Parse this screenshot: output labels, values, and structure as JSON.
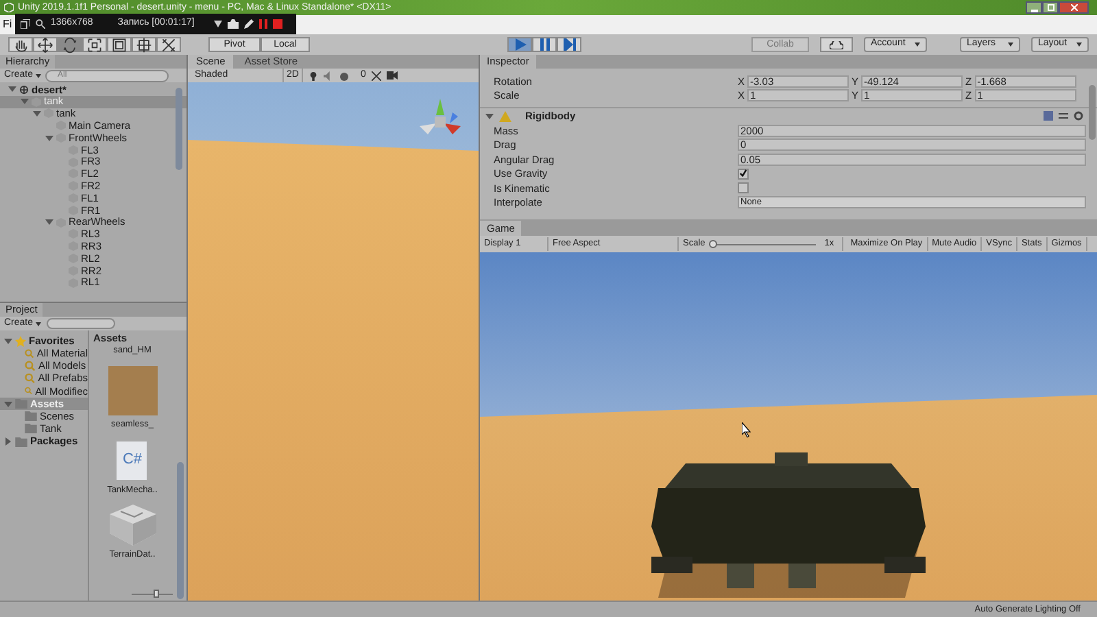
{
  "window": {
    "title": "Unity 2019.1.1f1 Personal - desert.unity - menu - PC, Mac & Linux Standalone* <DX11>"
  },
  "recorder": {
    "resolution": "1366x768",
    "status": "Запись [00:01:17]"
  },
  "menu_bar": {
    "items": [
      "Fi"
    ]
  },
  "toolbar": {
    "tools": [
      {
        "kind": "hand",
        "selected": false
      },
      {
        "kind": "move",
        "selected": false
      },
      {
        "kind": "rotate",
        "selected": true
      },
      {
        "kind": "scale",
        "selected": false
      },
      {
        "kind": "rect",
        "selected": false
      },
      {
        "kind": "transform",
        "selected": false
      },
      {
        "kind": "custom",
        "selected": false
      }
    ],
    "pivot": "Pivot",
    "local": "Local",
    "playback": [
      {
        "kind": "play",
        "selected": true
      },
      {
        "kind": "pause",
        "selected": false
      },
      {
        "kind": "step",
        "selected": false
      }
    ],
    "collab": "Collab",
    "account": "Account",
    "layers": "Layers",
    "layout": "Layout"
  },
  "hierarchy": {
    "title": "Hierarchy",
    "create": "Create",
    "search_placeholder": "All",
    "tree": [
      {
        "label": "desert*",
        "selected": false,
        "expanded": true,
        "children": [
          {
            "label": "tank",
            "selected": true,
            "expanded": true,
            "children": [
              {
                "label": "tank",
                "selected": false,
                "expanded": true,
                "children": [
                  {
                    "label": "Main Camera",
                    "selected": false
                  },
                  {
                    "label": "FrontWheels",
                    "selected": false,
                    "expanded": true,
                    "children": [
                      {
                        "label": "FL3",
                        "selected": false
                      },
                      {
                        "label": "FR3",
                        "selected": false
                      },
                      {
                        "label": "FL2",
                        "selected": false
                      },
                      {
                        "label": "FR2",
                        "selected": false
                      },
                      {
                        "label": "FL1",
                        "selected": false
                      },
                      {
                        "label": "FR1",
                        "selected": false
                      }
                    ]
                  },
                  {
                    "label": "RearWheels",
                    "selected": false,
                    "expanded": true,
                    "children": [
                      {
                        "label": "RL3",
                        "selected": false
                      },
                      {
                        "label": "RR3",
                        "selected": false
                      },
                      {
                        "label": "RL2",
                        "selected": false
                      },
                      {
                        "label": "RR2",
                        "selected": false
                      },
                      {
                        "label": "RL1",
                        "selected": false
                      }
                    ]
                  }
                ]
              }
            ]
          }
        ]
      }
    ]
  },
  "project": {
    "title": "Project",
    "create": "Create",
    "tree": [
      {
        "label": "Favorites",
        "kind": "favorites",
        "selected": false,
        "expanded": true,
        "children": [
          {
            "label": "All Material",
            "kind": "search",
            "selected": false
          },
          {
            "label": "All Models",
            "kind": "search",
            "selected": false
          },
          {
            "label": "All Prefabs",
            "kind": "search",
            "selected": false
          },
          {
            "label": "All Modifiec",
            "kind": "search",
            "selected": false
          }
        ]
      },
      {
        "label": "Assets",
        "kind": "folder",
        "selected": true,
        "expanded": true,
        "children": [
          {
            "label": "Scenes",
            "kind": "folder",
            "selected": false
          },
          {
            "label": "Tank",
            "kind": "folder",
            "selected": false
          }
        ]
      },
      {
        "label": "Packages",
        "kind": "folder",
        "selected": false,
        "expanded": false
      }
    ],
    "breadcrumb": "Assets",
    "zoom": {
      "level": 0.6
    },
    "assets": [
      {
        "label": "sand_HM",
        "kind": "none"
      },
      {
        "label": "seamless_",
        "kind": "texture"
      },
      {
        "label": "TankMecha..",
        "kind": "script",
        "icon_text": "C#"
      },
      {
        "label": "TerrainDat..",
        "kind": "terrain"
      }
    ]
  },
  "scene": {
    "tabs": [
      {
        "label": "Scene",
        "selected": true
      },
      {
        "label": "Asset Store",
        "selected": false
      }
    ],
    "shading": "Shaded",
    "mode_2d": "2D",
    "hidden_count": "0"
  },
  "inspector": {
    "title": "Inspector",
    "transform_rows": [
      {
        "label": "Rotation",
        "axes": [
          {
            "axis": "X",
            "value": "-3.03"
          },
          {
            "axis": "Y",
            "value": "-49.124"
          },
          {
            "axis": "Z",
            "value": "-1.668"
          }
        ]
      },
      {
        "label": "Scale",
        "axes": [
          {
            "axis": "X",
            "value": "1"
          },
          {
            "axis": "Y",
            "value": "1"
          },
          {
            "axis": "Z",
            "value": "1"
          }
        ]
      }
    ],
    "component": {
      "name": "Rigidbody",
      "expanded": true
    },
    "fields": [
      {
        "kind": "text",
        "label": "Mass",
        "value": "2000"
      },
      {
        "kind": "text",
        "label": "Drag",
        "value": "0"
      },
      {
        "kind": "text",
        "label": "Angular Drag",
        "value": "0.05"
      },
      {
        "kind": "check",
        "label": "Use Gravity",
        "checked": true
      },
      {
        "kind": "check",
        "label": "Is Kinematic",
        "checked": false
      },
      {
        "kind": "dropdown",
        "label": "Interpolate",
        "value": "None"
      }
    ]
  },
  "game": {
    "tab": "Game",
    "display": "Display 1",
    "aspect": "Free Aspect",
    "scale_label": "Scale",
    "scale": {
      "level": 0.0
    },
    "scale_value": "1x",
    "buttons": [
      "Maximize On Play",
      "Mute Audio",
      "VSync",
      "Stats",
      "Gizmos"
    ]
  },
  "status_bar": {
    "text": "Auto Generate Lighting Off"
  }
}
